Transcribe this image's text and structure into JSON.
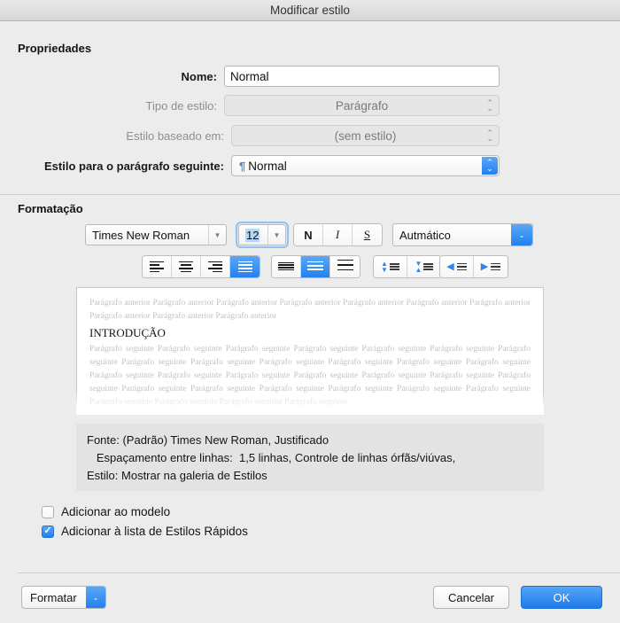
{
  "window": {
    "title": "Modificar estilo"
  },
  "sections": {
    "properties_title": "Propriedades",
    "formatting_title": "Formatação"
  },
  "properties": {
    "name": {
      "label": "Nome:",
      "value": "Normal"
    },
    "style_type": {
      "label": "Tipo de estilo:",
      "value": "Parágrafo"
    },
    "based_on": {
      "label": "Estilo baseado em:",
      "value": "(sem estilo)"
    },
    "next_style": {
      "label": "Estilo para o parágrafo seguinte:",
      "value": "Normal",
      "glyph": "¶"
    }
  },
  "formatting": {
    "font_family": "Times New Roman",
    "font_size": "12",
    "bold_label": "N",
    "italic_label": "I",
    "underline_label": "S",
    "color": "Autmático",
    "align": [
      "align-left",
      "align-center",
      "align-right",
      "align-justify"
    ],
    "align_active": 3,
    "line_spacing": [
      "line-spacing-single",
      "line-spacing-1-5",
      "line-spacing-double"
    ],
    "line_spacing_active": 1,
    "spacing_buttons": [
      "decrease-paragraph-spacing",
      "increase-paragraph-spacing"
    ],
    "indent_buttons": [
      "decrease-indent",
      "increase-indent"
    ]
  },
  "preview": {
    "before_text": "Parágrafo anterior Parágrafo anterior Parágrafo anterior Parágrafo anterior Parágrafo anterior Parágrafo anterior Parágrafo anterior Parágrafo anterior Parágrafo anterior Parágrafo anterior",
    "heading": "INTRODUÇÃO",
    "after_text": "Parágrafo seguinte Parágrafo seguinte Parágrafo seguinte Parágrafo seguinte Parágrafo seguinte Parágrafo seguinte Parágrafo seguinte Parágrafo seguinte Parágrafo seguinte Parágrafo seguinte Parágrafo seguinte Parágrafo seguinte Parágrafo seguinte Parágrafo seguinte Parágrafo seguinte Parágrafo seguinte Parágrafo seguinte Parágrafo seguinte Parágrafo seguinte Parágrafo seguinte Parágrafo seguinte Parágrafo seguinte Parágrafo seguinte Parágrafo seguinte Parágrafo seguinte Parágrafo seguinte Parágrafo seguinte Parágrafo seguinte Parágrafo seguinte Parágrafo seguinte"
  },
  "description": {
    "line1": "Fonte: (Padrão) Times New Roman, Justificado",
    "line2": "   Espaçamento entre linhas:  1,5 linhas, Controle de linhas órfãs/viúvas,",
    "line3": "Estilo: Mostrar na galeria de Estilos"
  },
  "checkboxes": {
    "add_to_template": {
      "label": "Adicionar ao modelo",
      "checked": false
    },
    "add_to_quick_styles": {
      "label": "Adicionar à lista de Estilos Rápidos",
      "checked": true
    }
  },
  "footer": {
    "format_button": "Formatar",
    "cancel_button": "Cancelar",
    "ok_button": "OK"
  },
  "colors": {
    "accent": "#2180ef",
    "accent_light": "#5aa8f7",
    "window_bg": "#ececec",
    "divider": "#cfcfcf"
  }
}
